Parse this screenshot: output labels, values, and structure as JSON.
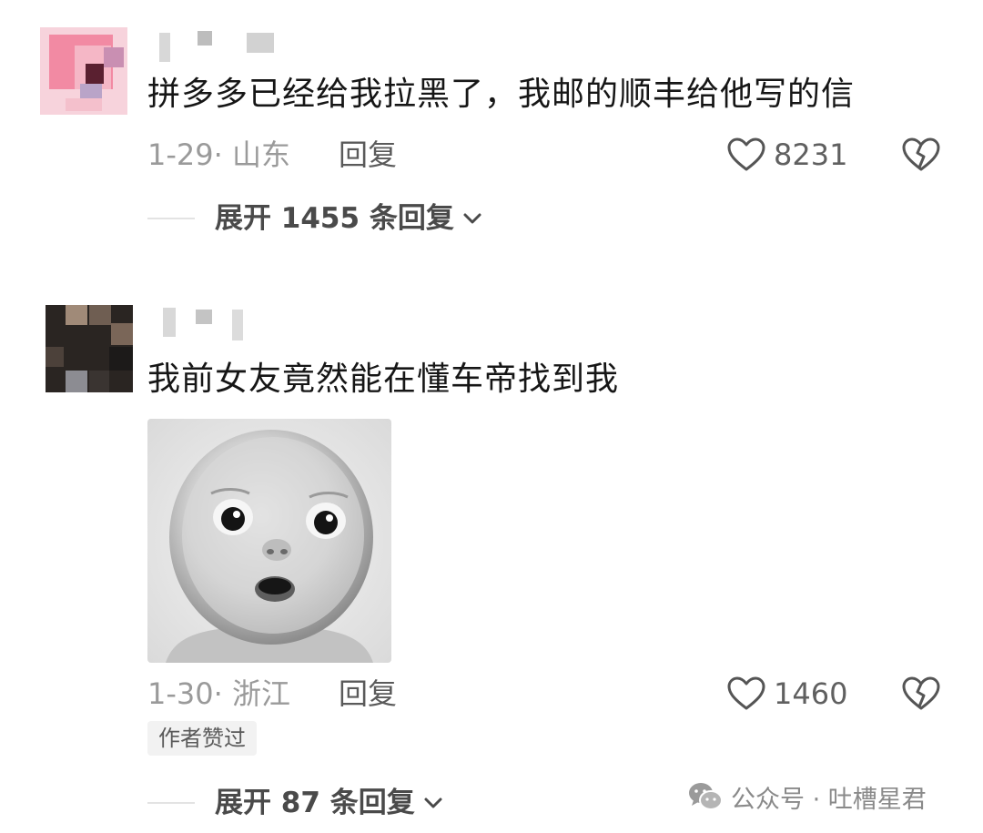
{
  "comments": [
    {
      "text": "拼多多已经给我拉黑了，我邮的顺丰给他写的信",
      "date": "1-29",
      "separator": "·",
      "location": "山东",
      "reply_label": "回复",
      "likes": "8231",
      "expand_label": "展开 1455 条回复"
    },
    {
      "text": "我前女友竟然能在懂车帝找到我",
      "date": "1-30",
      "separator": "·",
      "location": "浙江",
      "reply_label": "回复",
      "likes": "1460",
      "author_badge": "作者赞过",
      "expand_label": "展开 87 条回复"
    }
  ],
  "watermark": {
    "text": "公众号 · 吐槽星君",
    "icon": "wechat-icon"
  },
  "icons": {
    "like": "heart-outline-icon",
    "dislike": "broken-heart-icon",
    "expand": "chevron-down-icon"
  },
  "colors": {
    "text": "#161616",
    "meta": "#9a9a9a",
    "secondary": "#5a5a5a",
    "badge_bg": "#f2f2f2"
  }
}
